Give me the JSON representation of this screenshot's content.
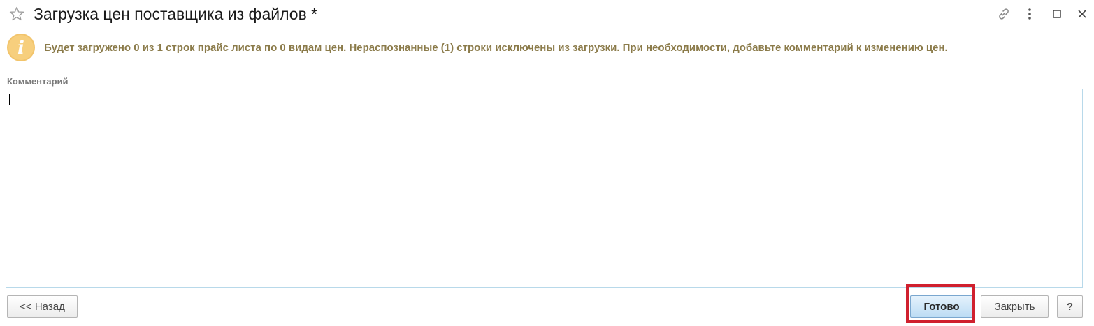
{
  "window": {
    "title": "Загрузка цен поставщика из файлов *"
  },
  "header_icons": [
    "star-icon",
    "link-icon",
    "more-icon",
    "maximize-icon",
    "close-icon"
  ],
  "message": {
    "icon": "info-icon",
    "text": "Будет загружено 0 из 1 строк прайс листа по 0 видам цен. Нераспознанные (1) строки исключены из загрузки. При необходимости, добавьте комментарий к изменению цен."
  },
  "comment": {
    "label": "Комментарий",
    "value": ""
  },
  "buttons": {
    "back": "<< Назад",
    "done": "Готово",
    "close": "Закрыть",
    "help": "?"
  },
  "colors": {
    "message_text": "#8b7b4a",
    "info_icon": "#f2c46b",
    "field_border": "#b8d9ea",
    "primary_button": "#bcdcf4",
    "highlight": "#d0202e"
  }
}
